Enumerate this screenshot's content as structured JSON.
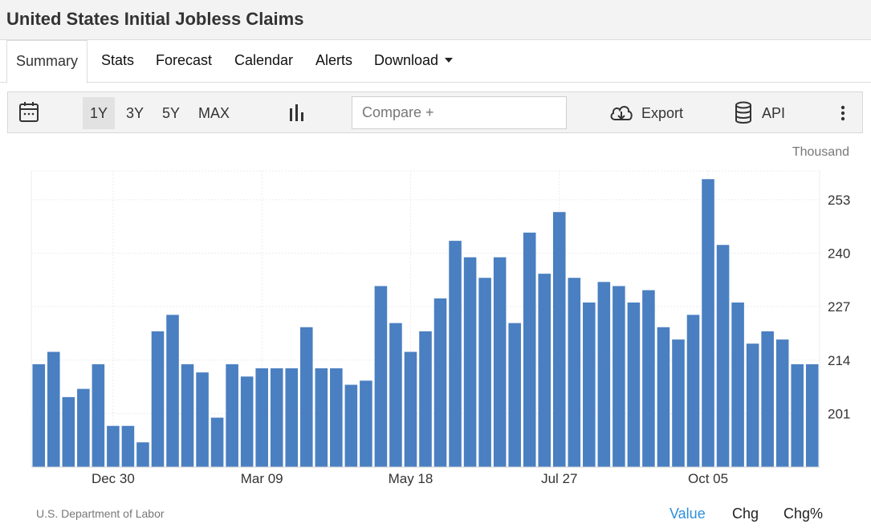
{
  "page": {
    "title": "United States Initial Jobless Claims"
  },
  "tabs": [
    {
      "label": "Summary"
    },
    {
      "label": "Stats"
    },
    {
      "label": "Forecast"
    },
    {
      "label": "Calendar"
    },
    {
      "label": "Alerts"
    },
    {
      "label": "Download"
    }
  ],
  "toolbar": {
    "ranges": [
      "1Y",
      "3Y",
      "5Y",
      "MAX"
    ],
    "active_range": "1Y",
    "compare_placeholder": "Compare +",
    "export_label": "Export",
    "api_label": "API"
  },
  "footer": {
    "source": "U.S. Department of Labor",
    "views": [
      "Value",
      "Chg",
      "Chg%"
    ],
    "active_view": "Value"
  },
  "colors": {
    "bar": "#4a7fc1",
    "accent": "#2f8fdb"
  },
  "icons": [
    "calendar-icon",
    "bar-chart-icon",
    "cloud-download-icon",
    "database-icon",
    "more-vertical-icon"
  ],
  "chart_data": {
    "type": "bar",
    "unit_label": "Thousand",
    "ylim": [
      188,
      260
    ],
    "yticks": [
      201,
      214,
      227,
      240,
      253
    ],
    "xtick_labels": [
      "Dec 30",
      "Mar 09",
      "May 18",
      "Jul 27",
      "Oct 05"
    ],
    "xtick_bar_index": [
      5,
      15,
      25,
      35,
      45
    ],
    "grid": true,
    "values": [
      213,
      216,
      205,
      207,
      213,
      198,
      198,
      194,
      221,
      225,
      213,
      211,
      200,
      213,
      210,
      212,
      212,
      212,
      222,
      212,
      212,
      208,
      209,
      232,
      223,
      216,
      221,
      229,
      243,
      239,
      234,
      239,
      223,
      245,
      235,
      250,
      234,
      228,
      233,
      232,
      228,
      231,
      222,
      219,
      225,
      258,
      242,
      228,
      218,
      221,
      219,
      213,
      213
    ]
  }
}
